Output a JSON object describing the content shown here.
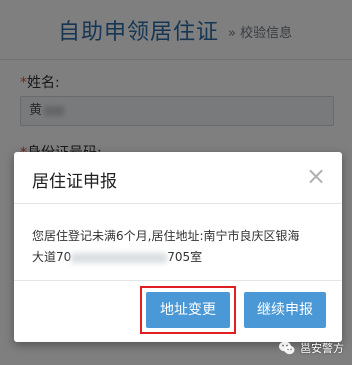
{
  "page": {
    "title": "自助申领居住证",
    "subtitle": "» 校验信息",
    "name_label": "姓名:",
    "name_value": "黄",
    "id_label": "身份证号码:",
    "required_mark": "*"
  },
  "modal": {
    "title": "居住证申报",
    "close_symbol": "×",
    "message_line1": "您居住登记未满6个月,居住地址:南宁市良庆区银海",
    "message_line2_start": "大道70",
    "message_line2_end": "705室",
    "buttons": {
      "change_address": "地址变更",
      "continue": "继续申报"
    }
  },
  "watermark": {
    "text": "邕安警方",
    "icon": "wechat-icon"
  },
  "colors": {
    "title_blue": "#2c6da8",
    "button_blue": "#4a98d6",
    "highlight_red": "#e02020",
    "required_red": "#d9534f"
  }
}
